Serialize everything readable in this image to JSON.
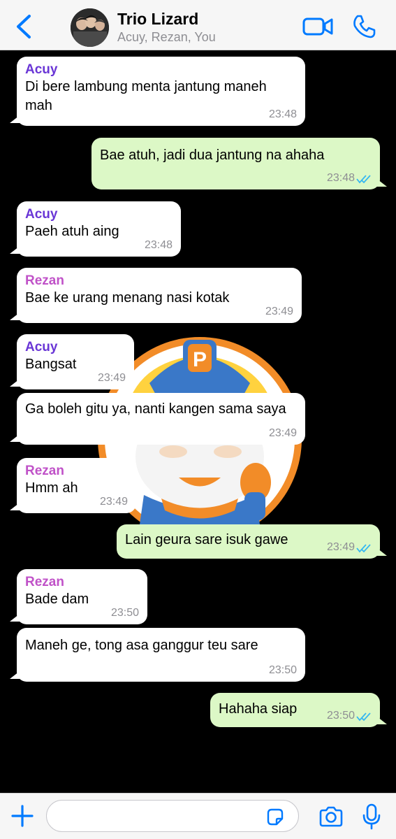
{
  "header": {
    "title": "Trio Lizard",
    "subtitle": "Acuy, Rezan, You",
    "accent": "#007aff"
  },
  "colors": {
    "acuy": "#6a36d6",
    "rezan": "#c052c8",
    "incoming_bg": "#ffffff",
    "outgoing_bg": "#dcf8c6",
    "read_ticks": "#34b7f1"
  },
  "messages": [
    {
      "sender": "Acuy",
      "text": "Di bere lambung menta jantung maneh mah",
      "time": "23:48"
    },
    {
      "text": "Bae atuh, jadi dua jantung na ahaha",
      "time": "23:48"
    },
    {
      "sender": "Acuy",
      "text": "Paeh atuh aing",
      "time": "23:48"
    },
    {
      "sender": "Rezan",
      "text": "Bae ke urang menang nasi kotak",
      "time": "23:49"
    },
    {
      "sender": "Acuy",
      "text": "Bangsat",
      "time": "23:49"
    },
    {
      "text": "Ga boleh gitu ya, nanti kangen sama saya",
      "time": "23:49"
    },
    {
      "sender": "Rezan",
      "text": "Hmm ah",
      "time": "23:49"
    },
    {
      "text": "Lain geura sare isuk gawe",
      "time": "23:49"
    },
    {
      "sender": "Rezan",
      "text": "Bade dam",
      "time": "23:50"
    },
    {
      "text": "Maneh ge, tong asa ganggur teu sare",
      "time": "23:50"
    },
    {
      "text": "Hahaha siap",
      "time": "23:50"
    }
  ],
  "composer": {
    "placeholder": ""
  },
  "sticker": {
    "badge_letter": "P"
  }
}
